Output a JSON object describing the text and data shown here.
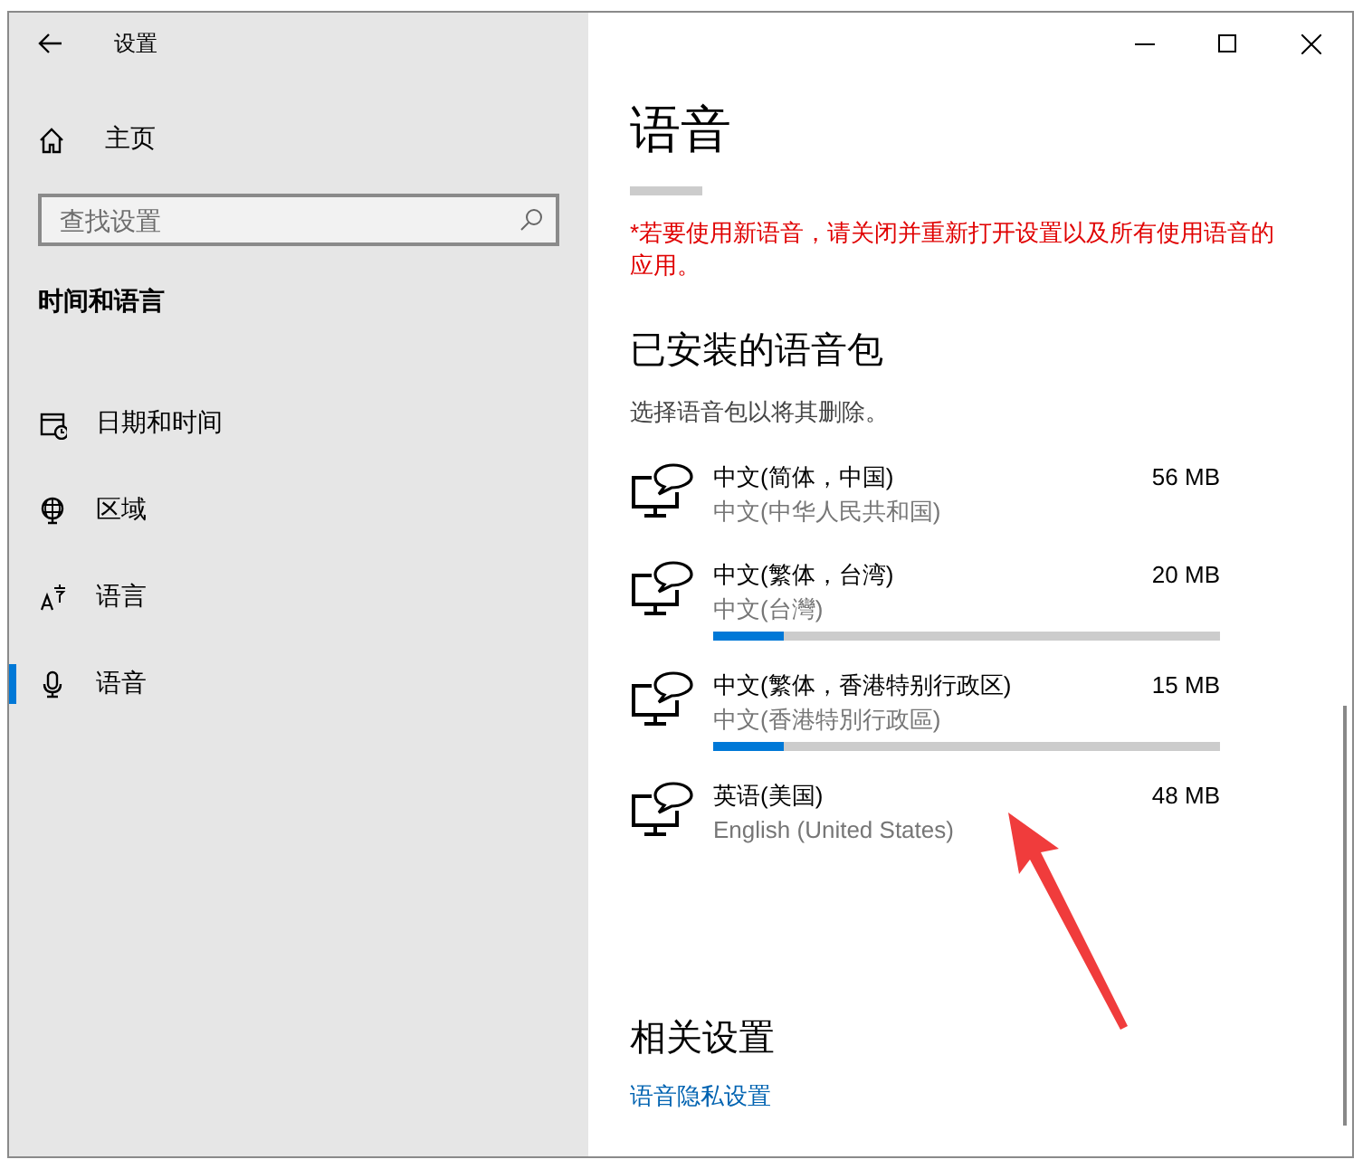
{
  "window": {
    "title": "设置"
  },
  "sidebar": {
    "home": "主页",
    "search": {
      "placeholder": "查找设置"
    },
    "section": "时间和语言",
    "items": [
      {
        "label": "日期和时间",
        "selected": false
      },
      {
        "label": "区域",
        "selected": false
      },
      {
        "label": "语言",
        "selected": false
      },
      {
        "label": "语音",
        "selected": true
      }
    ]
  },
  "page": {
    "title": "语音",
    "warning": "*若要使用新语音，请关闭并重新打开设置以及所有使用语音的应用。",
    "installed": {
      "heading": "已安装的语音包",
      "hint": "选择语音包以将其删除。",
      "packs": [
        {
          "name": "中文(简体，中国)",
          "subtitle": "中文(中华人民共和国)",
          "size": "56 MB"
        },
        {
          "name": "中文(繁体，台湾)",
          "subtitle": "中文(台灣)",
          "size": "20 MB",
          "level": 0.14
        },
        {
          "name": "中文(繁体，香港特别行政区)",
          "subtitle": "中文(香港特別行政區)",
          "size": "15 MB",
          "level": 0.14
        },
        {
          "name": "英语(美国)",
          "subtitle": "English (United States)",
          "size": "48 MB"
        }
      ]
    },
    "related": {
      "heading": "相关设置",
      "link": "语音隐私设置"
    }
  }
}
